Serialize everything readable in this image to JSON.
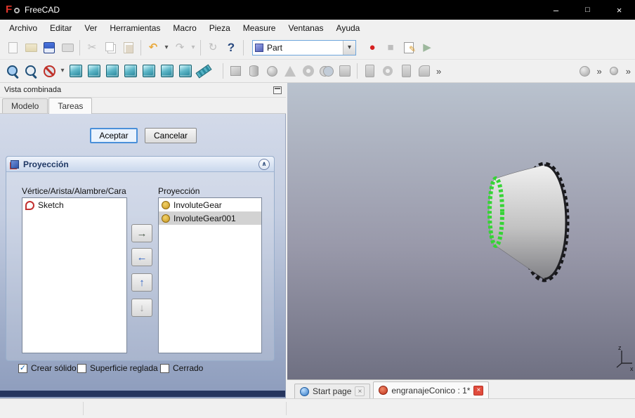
{
  "window": {
    "title": "FreeCAD",
    "minimize": "–",
    "maximize": "□",
    "close": "×"
  },
  "menu": {
    "items": [
      "Archivo",
      "Editar",
      "Ver",
      "Herramientas",
      "Macro",
      "Pieza",
      "Measure",
      "Ventanas",
      "Ayuda"
    ]
  },
  "toolbar": {
    "workbench": "Part"
  },
  "glyphs": {
    "dropdown": "▾",
    "scissors": "✂",
    "undo": "↶",
    "redo": "↷",
    "refresh": "↻",
    "help": "?",
    "record": "●",
    "stop": "■",
    "play": "▶",
    "pencil": "✎",
    "arrow_right": "→",
    "arrow_left": "←",
    "arrow_up": "↑",
    "arrow_down": "↓",
    "check": "✓",
    "collapse": "∧",
    "close_tab": "×",
    "more": "»"
  },
  "combo_view": {
    "title": "Vista combinada",
    "tab_model": "Modelo",
    "tab_tasks": "Tareas",
    "task": {
      "accept": "Aceptar",
      "cancel": "Cancelar",
      "section_title": "Proyección",
      "source_label": "Vértice/Arista/Alambre/Cara",
      "projection_label": "Proyección",
      "source_items": [
        "Sketch"
      ],
      "projection_items": [
        "InvoluteGear",
        "InvoluteGear001"
      ],
      "selected_projection": "InvoluteGear001",
      "checkboxes": [
        {
          "label": "Crear sólido",
          "checked": true
        },
        {
          "label": "Superficie reglada",
          "checked": false
        },
        {
          "label": "Cerrado",
          "checked": false
        }
      ]
    }
  },
  "viewport": {
    "tab_start_page": "Start page",
    "tab_document": "engranajeConico : 1*",
    "axis_z": "z",
    "axis_x": "x",
    "colors": {
      "background_top": "#b9c2ce",
      "background_bottom": "#6f7082",
      "cone_light": "#efefef",
      "cone_dark": "#8a8a8a",
      "selection_highlight": "#35d435",
      "gear_teeth": "#17171a"
    }
  }
}
